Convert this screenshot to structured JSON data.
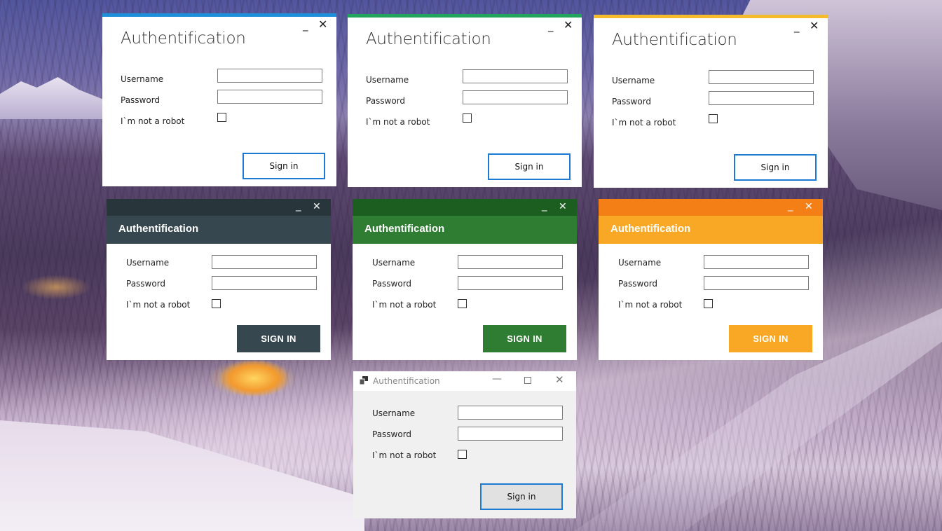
{
  "background": {
    "scene": "snowy mountain village at dusk"
  },
  "windows": [
    {
      "id": "metro-blue",
      "style": "metro",
      "accent": "#1e8fd8"
    },
    {
      "id": "metro-green",
      "style": "metro",
      "accent": "#21a45c"
    },
    {
      "id": "metro-yellow",
      "style": "metro",
      "accent": "#f4bc2c"
    },
    {
      "id": "material-dark",
      "style": "material",
      "bar_color": "#28363b",
      "header_color": "#37474f",
      "button_color": "#37474f"
    },
    {
      "id": "material-green",
      "style": "material",
      "bar_color": "#1b5e20",
      "header_color": "#2e7d32",
      "button_color": "#2e7d32"
    },
    {
      "id": "material-orange",
      "style": "material",
      "bar_color": "#f57f17",
      "header_color": "#f9a825",
      "button_color": "#f9a825"
    },
    {
      "id": "classic",
      "style": "classic"
    }
  ],
  "form": {
    "title": "Authentification",
    "username_label": "Username",
    "password_label": "Password",
    "robot_label": "I`m not a robot",
    "username_value": "",
    "password_value": "",
    "robot_checked": false,
    "sign_in": "Sign in",
    "sign_in_caps": "SIGN IN"
  },
  "controls": {
    "minimize_glyph": "_",
    "close_glyph": "✕",
    "classic_minimize_glyph": "—"
  }
}
